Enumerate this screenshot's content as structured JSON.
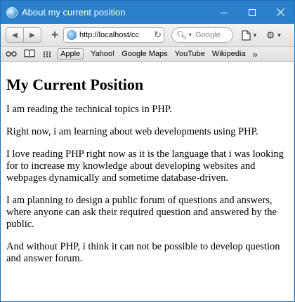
{
  "window": {
    "title": "About my current position"
  },
  "toolbar": {
    "back_icon": "back-arrow-icon",
    "forward_icon": "forward-arrow-icon",
    "add_icon": "plus-icon",
    "url": "http://localhost/cc",
    "reload_icon": "reload-icon",
    "search_placeholder": "Google"
  },
  "bookmarks": {
    "items": [
      "Apple",
      "Yahoo!",
      "Google Maps",
      "YouTube",
      "Wikipedia"
    ],
    "active": "Apple"
  },
  "page": {
    "heading": "My Current Position",
    "paragraphs": [
      "I am reading the technical topics in PHP.",
      "Right now, i am learning about web developments using PHP.",
      "I love reading PHP right now as it is the language that i was looking for to increase my knowledge about developing websites and webpages dynamically and sometime database-driven.",
      "I am planning to design a public forum of questions and answers, where anyone can ask their required question and answered by the public.",
      "And without PHP, i think it can not be possible to develop question and answer forum."
    ]
  }
}
